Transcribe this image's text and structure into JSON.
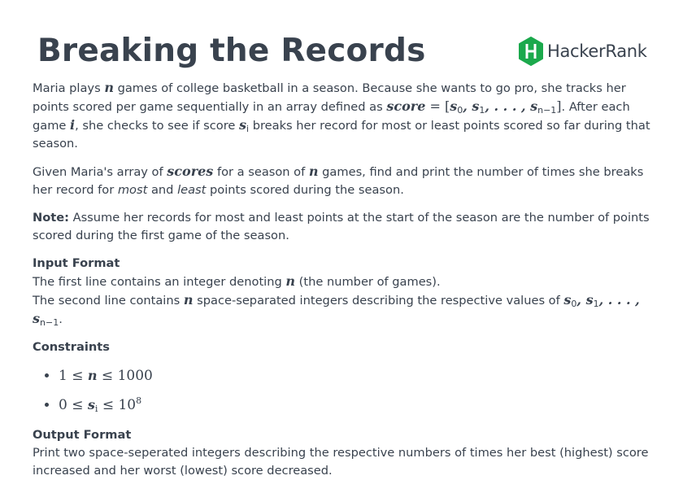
{
  "header": {
    "title": "Breaking the Records",
    "brand_name": "HackerRank",
    "brand_color": "#1ba94c"
  },
  "description": {
    "p1_a": "Maria plays ",
    "p1_var_n": "n",
    "p1_b": " games of college basketball in a season. Because she wants to go pro, she tracks her points scored per game sequentially in an array defined as ",
    "p1_score_word": "score",
    "p1_equals": " = [",
    "p1_s0": "s",
    "p1_sub0": "0",
    "p1_s1": ", s",
    "p1_sub1": "1",
    "p1_dots": ", . . . , s",
    "p1_subn": "n−1",
    "p1_close": "]",
    "p1_c": ". After each game ",
    "p1_var_i": "i",
    "p1_d": ", she checks to see if score ",
    "p1_si": "s",
    "p1_sub_i": "i",
    "p1_e": " breaks her record for most or least points scored so far during that season.",
    "p2_a": "Given Maria's array of ",
    "p2_scores": "scores",
    "p2_b": " for a season of ",
    "p2_var_n": "n",
    "p2_c": " games, find and print the number of times she breaks her record for ",
    "p2_most": "most",
    "p2_and": " and ",
    "p2_least": "least",
    "p2_d": " points scored during the season.",
    "note_label": "Note:",
    "note_text": " Assume her records for most and least points at the start of the season are the number of points scored during the first game of the season."
  },
  "input_format": {
    "heading": "Input Format",
    "line1_a": "The first line contains an integer denoting ",
    "line1_var": "n",
    "line1_b": " (the number of games).",
    "line2_a": "The second line contains ",
    "line2_var": "n",
    "line2_b": " space-separated integers describing the respective values of ",
    "line2_s0": "s",
    "line2_sub0": "0",
    "line2_s1": ", s",
    "line2_sub1": "1",
    "line2_dots": ", . . . , s",
    "line2_subn": "n−1",
    "line2_end": "."
  },
  "constraints": {
    "heading": "Constraints",
    "c1_a": "1 ≤ ",
    "c1_var": "n",
    "c1_b": " ≤ 1000",
    "c2_a": "0 ≤ ",
    "c2_var": "s",
    "c2_sub": "i",
    "c2_b": " ≤ 10",
    "c2_sup": "8"
  },
  "output_format": {
    "heading": "Output Format",
    "text": "Print two space-seperated integers describing the respective numbers of times her best (highest) score increased and her worst (lowest) score decreased."
  }
}
